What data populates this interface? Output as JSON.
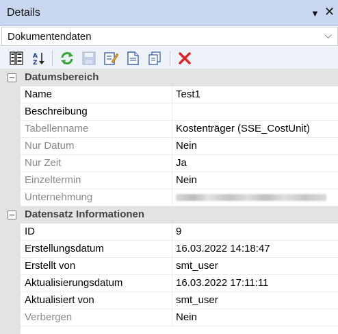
{
  "panel": {
    "title": "Details",
    "dropdown_glyph": "▼",
    "close_glyph": "✕"
  },
  "view_selector": {
    "value": "Dokumentendaten",
    "chevron_glyph": "⌵"
  },
  "toolbar": {
    "buttons": [
      {
        "icon": "categorized-view-icon",
        "enabled": true
      },
      {
        "icon": "sort-alphabetical-icon",
        "enabled": true
      },
      {
        "icon": "refresh-icon",
        "enabled": true
      },
      {
        "icon": "save-icon",
        "enabled": false
      },
      {
        "icon": "edit-icon",
        "enabled": true
      },
      {
        "icon": "new-document-icon",
        "enabled": true
      },
      {
        "icon": "copy-icon",
        "enabled": true
      },
      {
        "icon": "delete-icon",
        "enabled": true
      }
    ]
  },
  "categories": [
    {
      "title": "Datumsbereich",
      "rows": [
        {
          "name": "Name",
          "value": "Test1",
          "readonly": false
        },
        {
          "name": "Beschreibung",
          "value": "",
          "readonly": false
        },
        {
          "name": "Tabellenname",
          "value": "Kostenträger (SSE_CostUnit)",
          "readonly": true
        },
        {
          "name": "Nur Datum",
          "value": "Nein",
          "readonly": true
        },
        {
          "name": "Nur Zeit",
          "value": "Ja",
          "readonly": true
        },
        {
          "name": "Einzeltermin",
          "value": "Nein",
          "readonly": true
        },
        {
          "name": "Unternehmung",
          "value": "",
          "readonly": true,
          "redacted": true
        }
      ]
    },
    {
      "title": "Datensatz Informationen",
      "rows": [
        {
          "name": "ID",
          "value": "9",
          "readonly": false
        },
        {
          "name": "Erstellungsdatum",
          "value": "16.03.2022 14:18:47",
          "readonly": false
        },
        {
          "name": "Erstellt von",
          "value": "smt_user",
          "readonly": false
        },
        {
          "name": "Aktualisierungsdatum",
          "value": "16.03.2022 17:11:11",
          "readonly": false
        },
        {
          "name": "Aktualisiert von",
          "value": "smt_user",
          "readonly": false
        },
        {
          "name": "Verbergen",
          "value": "Nein",
          "readonly": true
        }
      ]
    }
  ]
}
